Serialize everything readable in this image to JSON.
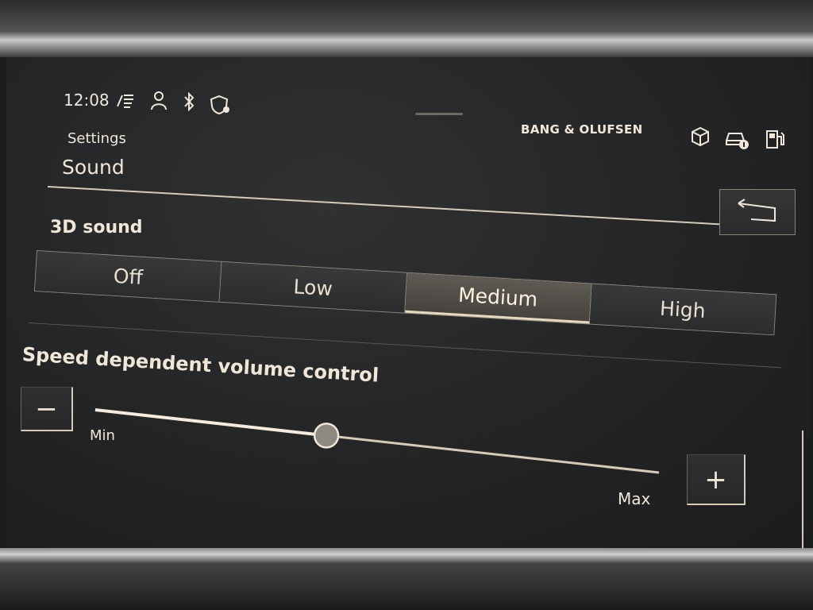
{
  "status_bar": {
    "time": "12:08",
    "brand": "BANG & OLUFSEN",
    "icons": [
      "traffic-info-icon",
      "person-icon",
      "bluetooth-icon",
      "location-shield-icon",
      "cube-icon",
      "car-info-icon",
      "fuel-icon"
    ]
  },
  "header": {
    "breadcrumb": "Settings",
    "title": "Sound"
  },
  "sound_3d": {
    "label": "3D sound",
    "options": [
      "Off",
      "Low",
      "Medium",
      "High"
    ],
    "selected": "Medium"
  },
  "speed_volume": {
    "label": "Speed dependent volume control",
    "min_label": "Min",
    "max_label": "Max",
    "minus_label": "−",
    "plus_label": "+",
    "level": 0.41
  },
  "colors": {
    "accent": "#f1e7d6",
    "background": "#222426"
  }
}
